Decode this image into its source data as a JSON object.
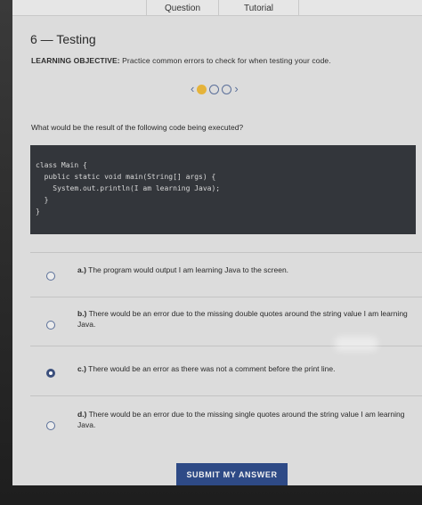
{
  "tabs": {
    "question": "Question",
    "tutorial": "Tutorial"
  },
  "header": {
    "title": "6 — Testing",
    "objective_label": "LEARNING OBJECTIVE:",
    "objective_text": "Practice common errors to check for when testing your code."
  },
  "pager": {
    "prev": "‹",
    "next": "›",
    "current_page": 1,
    "total_pages": 3,
    "active_color": "#e5b33a",
    "inactive_color": "#5a6f99"
  },
  "question": {
    "prompt": "What would be the result of the following code being executed?"
  },
  "code": {
    "lines": [
      "class Main {",
      "  public static void main(String[] args) {",
      "    System.out.println(I am learning Java);",
      "  }",
      "}"
    ]
  },
  "options": [
    {
      "letter": "a.)",
      "text": "The program would output I am learning Java to the screen.",
      "selected": false
    },
    {
      "letter": "b.)",
      "text": "There would be an error due to the missing double quotes around the string value I am learning Java.",
      "selected": false
    },
    {
      "letter": "c.)",
      "text": "There would be an error as there was not a comment before the print line.",
      "selected": true
    },
    {
      "letter": "d.)",
      "text": "There would be an error due to the missing single quotes around the string value I am learning Java.",
      "selected": false
    }
  ],
  "submit": {
    "label": "SUBMIT MY ANSWER"
  },
  "colors": {
    "accent": "#2e4a86",
    "code_bg": "#33363b"
  }
}
